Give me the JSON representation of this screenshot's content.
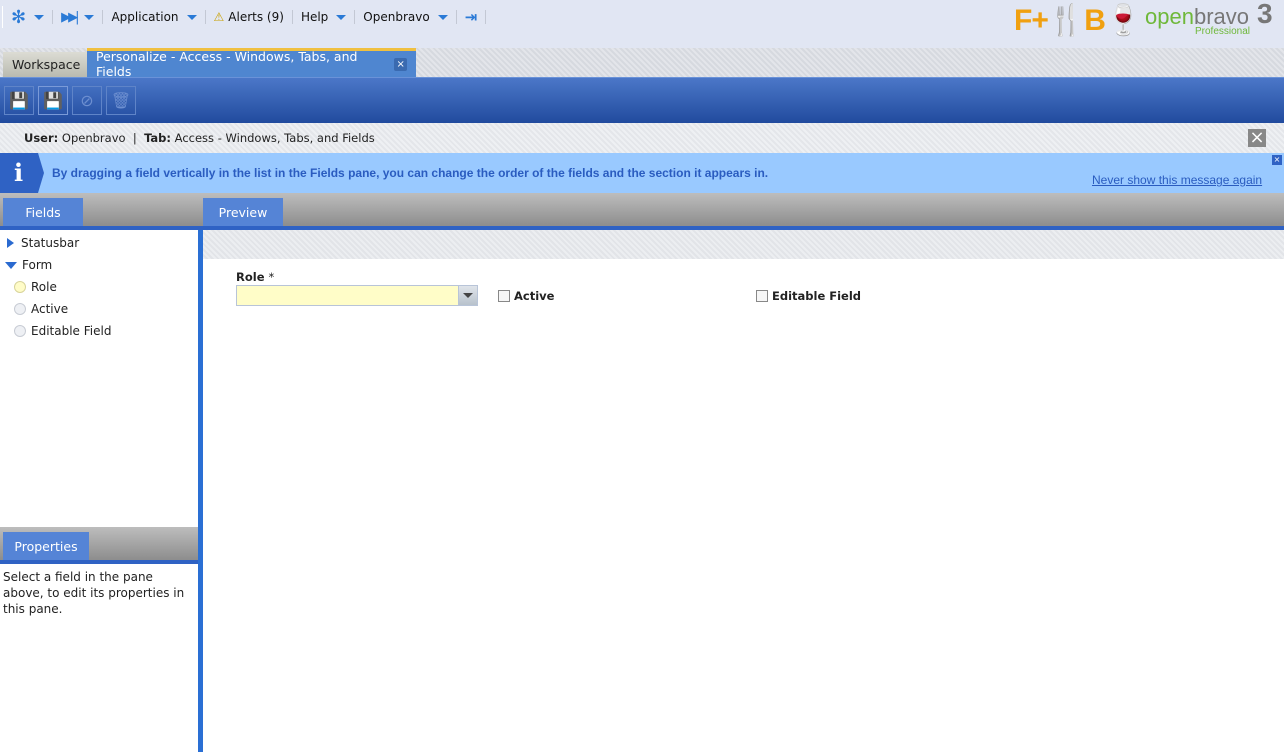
{
  "nav": {
    "items": [
      {
        "label": "",
        "icon": "asterisk-menu-icon"
      },
      {
        "label": "",
        "icon": "fast-forward-icon"
      },
      {
        "label": "Application"
      },
      {
        "label": "Alerts (9)",
        "icon": "warning-icon"
      },
      {
        "label": "Help"
      },
      {
        "label": "Openbravo"
      },
      {
        "label": "",
        "icon": "logout-icon"
      }
    ]
  },
  "logos": {
    "fnb": "F+B",
    "openbravo": "openbravo",
    "edition": "Professional",
    "version": "3"
  },
  "tabs": [
    {
      "label": "Workspace",
      "active": false
    },
    {
      "label": "Personalize - Access - Windows, Tabs, and Fields",
      "active": true,
      "close": "×"
    }
  ],
  "toolbar": {
    "buttons": [
      "save-icon",
      "save-close-icon",
      "cancel-icon",
      "delete-icon"
    ]
  },
  "info": {
    "user_label": "User:",
    "user": "Openbravo",
    "sep": "|",
    "tab_label": "Tab:",
    "tab": "Access - Windows, Tabs, and Fields",
    "close": "×"
  },
  "message": {
    "icon": "i",
    "text": "By dragging a field vertically in the list in the Fields pane, you can change the order of the fields and the section it appears in.",
    "link": "Never show this message again",
    "close": "×"
  },
  "fields_pane": {
    "title": "Fields",
    "tree": [
      {
        "label": "Statusbar",
        "type": "collapsed"
      },
      {
        "label": "Form",
        "type": "expanded"
      },
      {
        "label": "Role",
        "type": "required"
      },
      {
        "label": "Active",
        "type": "field"
      },
      {
        "label": "Editable Field",
        "type": "field"
      }
    ]
  },
  "properties_pane": {
    "title": "Properties",
    "text": "Select a field in the pane above, to edit its properties in this pane."
  },
  "preview": {
    "title": "Preview",
    "role_label": "Role",
    "required_mark": "*",
    "role_value": "",
    "active_label": "Active",
    "active_checked": false,
    "editable_label": "Editable Field",
    "editable_checked": false
  },
  "colors": {
    "accent": "#2f62c4",
    "message_bg": "#99c9ff",
    "required_field": "#fffdc8",
    "tab_highlight": "#f0c040"
  }
}
